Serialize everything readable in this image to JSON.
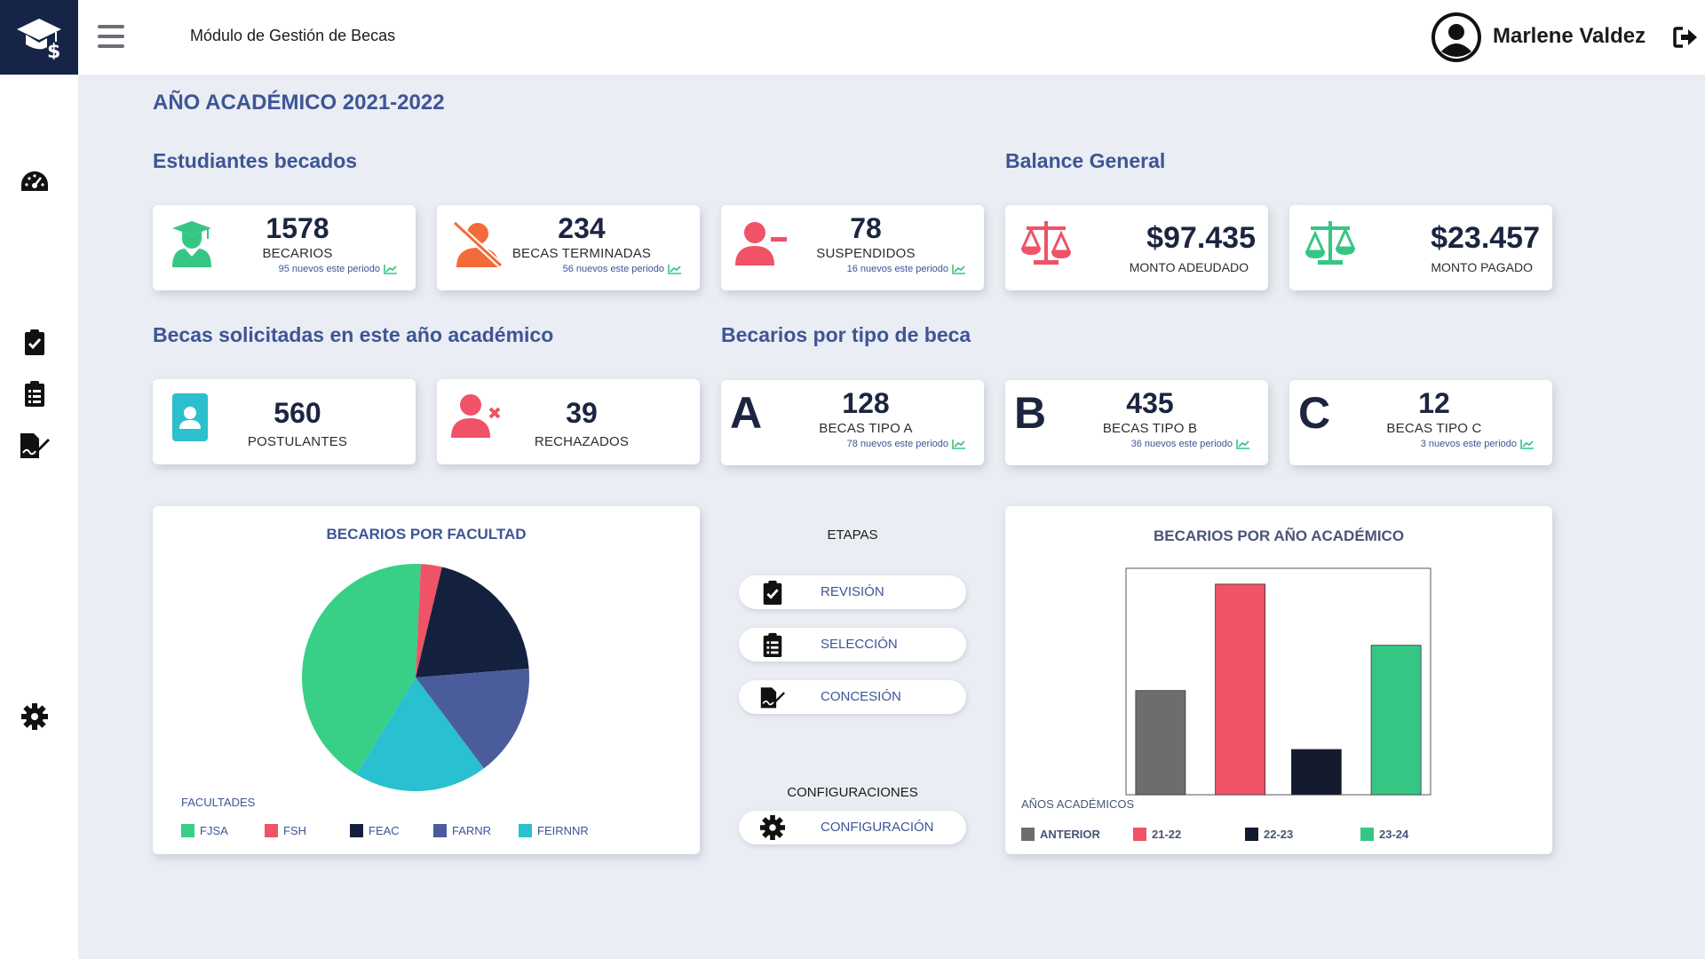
{
  "app": {
    "title": "Módulo de Gestión de Becas"
  },
  "user": {
    "name": "Marlene Valdez"
  },
  "heading": "AÑO ACADÉMICO 2021-2022",
  "sections": {
    "students": "Estudiantes becados",
    "balance": "Balance General",
    "requested": "Becas solicitadas en este año académico",
    "by_type": "Becarios por tipo de beca"
  },
  "student_cards": [
    {
      "value": "1578",
      "label": "BECARIOS",
      "sub": "95 nuevos este periodo",
      "icon": "graduate-icon",
      "color": "#36c684"
    },
    {
      "value": "234",
      "label": "BECAS TERMINADAS",
      "sub": "56 nuevos este periodo",
      "icon": "user-slash-icon",
      "color": "#f46b3b"
    },
    {
      "value": "78",
      "label": "SUSPENDIDOS",
      "sub": "16 nuevos este periodo",
      "icon": "user-minus-icon",
      "color": "#f05266"
    }
  ],
  "balance_cards": [
    {
      "value": "$97.435",
      "label": "MONTO ADEUDADO",
      "icon": "scale-icon",
      "color": "#f05266"
    },
    {
      "value": "$23.457",
      "label": "MONTO PAGADO",
      "icon": "scale-icon",
      "color": "#36c684"
    }
  ],
  "request_cards": [
    {
      "value": "560",
      "label": "POSTULANTES",
      "icon": "id-badge-icon",
      "color": "#2cbfcd"
    },
    {
      "value": "39",
      "label": "RECHAZADOS",
      "icon": "user-times-icon",
      "color": "#f05266"
    }
  ],
  "type_cards": [
    {
      "letter": "A",
      "value": "128",
      "label": "BECAS TIPO A",
      "sub": "78 nuevos este periodo"
    },
    {
      "letter": "B",
      "value": "435",
      "label": "BECAS TIPO B",
      "sub": "36 nuevos este periodo"
    },
    {
      "letter": "C",
      "value": "12",
      "label": "BECAS TIPO C",
      "sub": "3 nuevos este periodo"
    }
  ],
  "stages": {
    "title": "ETAPAS",
    "items": [
      {
        "label": "REVISIÓN",
        "icon": "clipboard-check-icon"
      },
      {
        "label": "SELECCIÓN",
        "icon": "clipboard-list-icon"
      },
      {
        "label": "CONCESIÓN",
        "icon": "file-signature-icon"
      }
    ],
    "config_title": "CONFIGURACIONES",
    "config_label": "CONFIGURACIÓN"
  },
  "chart_data": [
    {
      "type": "pie",
      "title": "BECARIOS POR FACULTAD",
      "legend_title": "FACULTADES",
      "categories": [
        "FJSA",
        "FSH",
        "FEAC",
        "FARNR",
        "FEIRNNR"
      ],
      "values": [
        42,
        3,
        20,
        16,
        19
      ],
      "colors": [
        "#38cf86",
        "#f05266",
        "#13213f",
        "#4b5c9c",
        "#29c0cf"
      ],
      "legend_position": "bottom"
    },
    {
      "type": "bar",
      "title": "BECARIOS POR AÑO ACADÉMICO",
      "legend_title": "AÑOS ACADÉMICOS",
      "categories": [
        "ANTERIOR",
        "21-22",
        "22-23",
        "23-24"
      ],
      "values": [
        46,
        93,
        20,
        66
      ],
      "colors": [
        "#6d6d6d",
        "#f05266",
        "#131a2e",
        "#36c684"
      ],
      "ylim": [
        0,
        100
      ],
      "legend_position": "bottom"
    }
  ]
}
